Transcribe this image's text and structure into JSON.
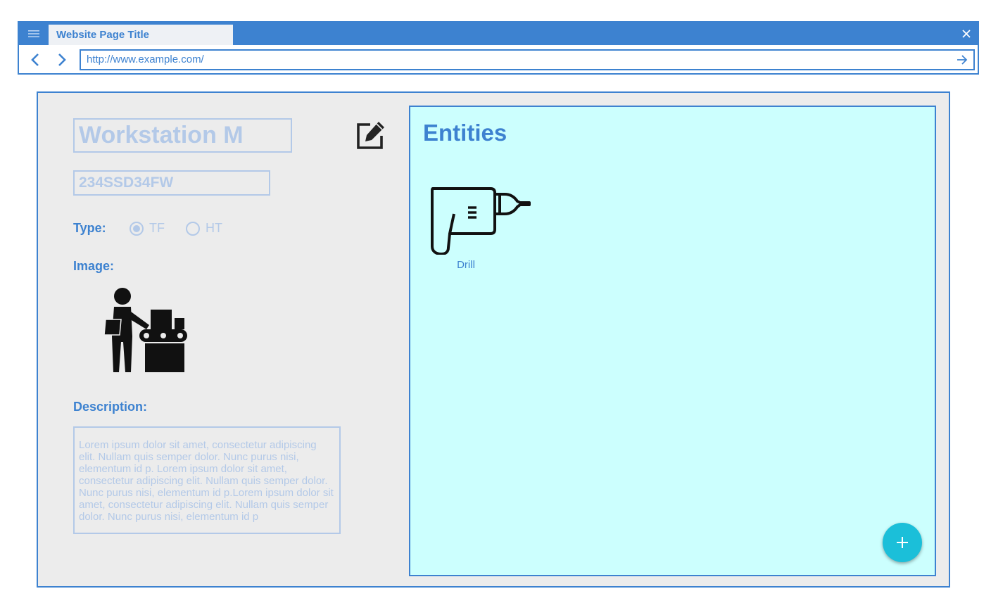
{
  "browser": {
    "tab_title": "Website Page Title",
    "url": "http://www.example.com/"
  },
  "form": {
    "name_value": "Workstation M",
    "serial_value": "234SSD34FW",
    "type_label": "Type:",
    "type_options": [
      {
        "label": "TF",
        "selected": true
      },
      {
        "label": "HT",
        "selected": false
      }
    ],
    "image_label": "Image:",
    "image_icon": "worker-at-workstation-icon",
    "description_label": "Description:",
    "description_value": "Lorem ipsum dolor sit amet, consectetur adipiscing elit. Nullam quis semper dolor. Nunc purus nisi, elementum id p. Lorem ipsum dolor sit amet, consectetur adipiscing elit. Nullam quis semper dolor. Nunc purus nisi, elementum id p.Lorem ipsum dolor sit amet, consectetur adipiscing elit. Nullam quis semper dolor. Nunc purus nisi, elementum id p"
  },
  "entities": {
    "title": "Entities",
    "items": [
      {
        "label": "Drill",
        "icon": "drill-icon"
      }
    ]
  },
  "colors": {
    "accent": "#3d82d0",
    "muted": "#b3c9e8",
    "panel_bg": "#ccfffe",
    "page_bg": "#ececec",
    "fab": "#1bbfd9"
  }
}
